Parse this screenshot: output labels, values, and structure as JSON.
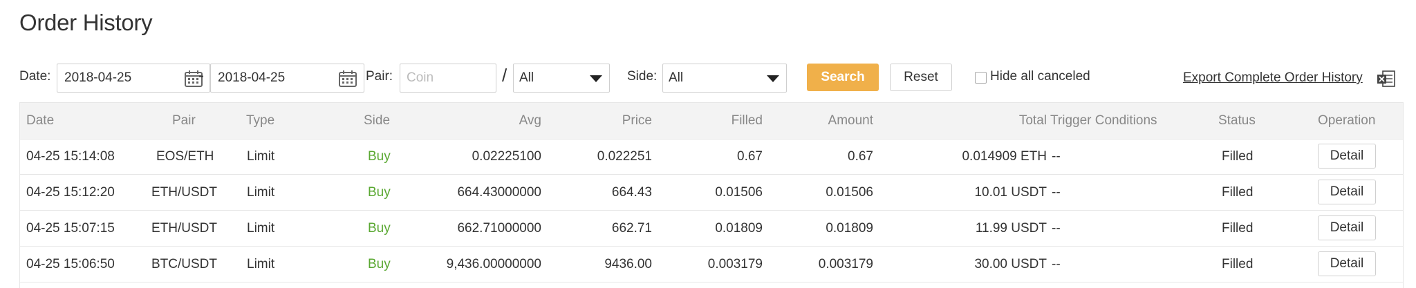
{
  "page": {
    "title": "Order History"
  },
  "filters": {
    "date_label": "Date:",
    "date_from": "2018-04-25",
    "date_separator": "-",
    "date_to": "2018-04-25",
    "pair_label": "Pair:",
    "coin_placeholder": "Coin",
    "pair_slash": "/",
    "quote_select": "All",
    "side_label": "Side:",
    "side_select": "All",
    "search_label": "Search",
    "reset_label": "Reset",
    "hide_canceled_label": "Hide all canceled",
    "hide_canceled_checked": false,
    "export_label": "Export Complete Order History"
  },
  "table": {
    "headers": {
      "date": "Date",
      "pair": "Pair",
      "type": "Type",
      "side": "Side",
      "avg": "Avg",
      "price": "Price",
      "filled": "Filled",
      "amount": "Amount",
      "total": "Total",
      "trigger": "Trigger Conditions",
      "status": "Status",
      "operation": "Operation"
    },
    "rows": [
      {
        "date": "04-25 15:14:08",
        "pair": "EOS/ETH",
        "type": "Limit",
        "side": "Buy",
        "avg": "0.02225100",
        "price": "0.022251",
        "filled": "0.67",
        "amount": "0.67",
        "total": "0.014909 ETH",
        "trigger": "--",
        "status": "Filled",
        "operation": "Detail"
      },
      {
        "date": "04-25 15:12:20",
        "pair": "ETH/USDT",
        "type": "Limit",
        "side": "Buy",
        "avg": "664.43000000",
        "price": "664.43",
        "filled": "0.01506",
        "amount": "0.01506",
        "total": "10.01 USDT",
        "trigger": "--",
        "status": "Filled",
        "operation": "Detail"
      },
      {
        "date": "04-25 15:07:15",
        "pair": "ETH/USDT",
        "type": "Limit",
        "side": "Buy",
        "avg": "662.71000000",
        "price": "662.71",
        "filled": "0.01809",
        "amount": "0.01809",
        "total": "11.99 USDT",
        "trigger": "--",
        "status": "Filled",
        "operation": "Detail"
      },
      {
        "date": "04-25 15:06:50",
        "pair": "BTC/USDT",
        "type": "Limit",
        "side": "Buy",
        "avg": "9,436.00000000",
        "price": "9436.00",
        "filled": "0.003179",
        "amount": "0.003179",
        "total": "30.00 USDT",
        "trigger": "--",
        "status": "Filled",
        "operation": "Detail"
      }
    ]
  },
  "colors": {
    "accent": "#f0b04a",
    "buy": "#5aa832",
    "header_bg": "#f3f3f3",
    "border": "#e6e6e6"
  },
  "icons": {
    "calendar": "calendar-icon",
    "dropdown": "chevron-down-icon",
    "export": "excel-icon"
  }
}
